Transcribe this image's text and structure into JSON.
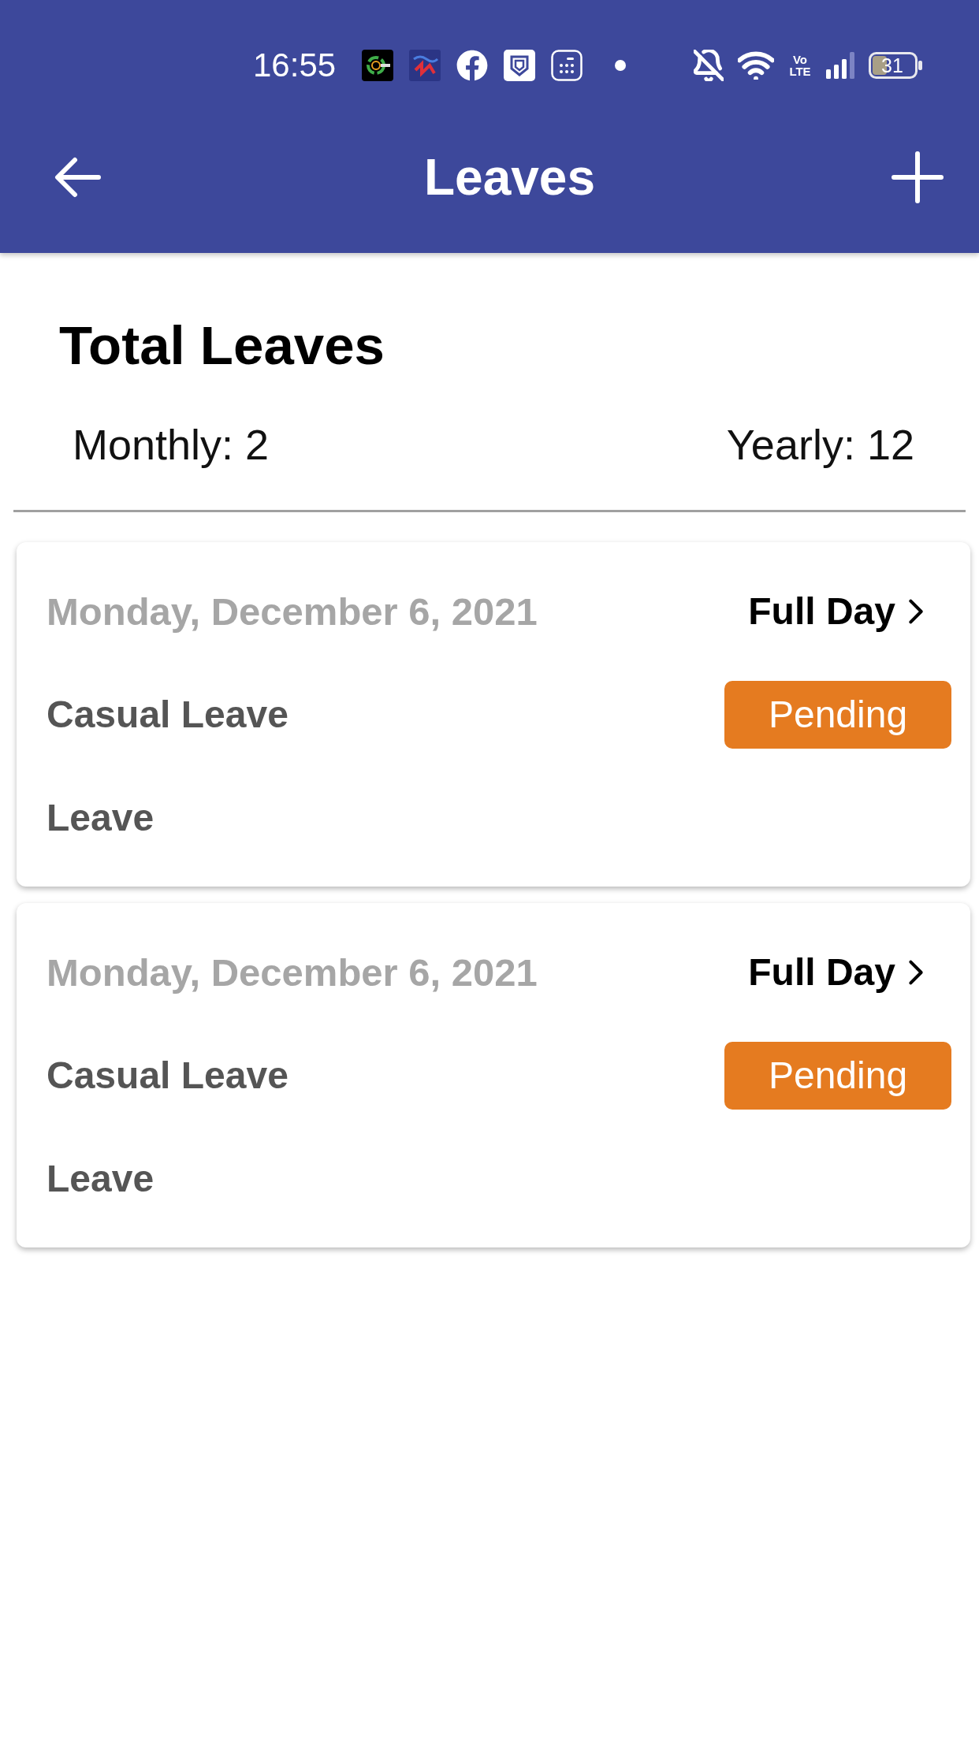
{
  "status_bar": {
    "time": "16:55",
    "network_label": "Vo LTE",
    "battery": "31"
  },
  "toolbar": {
    "title": "Leaves"
  },
  "summary": {
    "heading": "Total Leaves",
    "monthly": "Monthly: 2",
    "yearly": "Yearly: 12"
  },
  "leaves": [
    {
      "date": "Monday, December 6, 2021",
      "duration": "Full Day",
      "type": "Casual Leave",
      "status": {
        "label": "Pending",
        "color": "#e57b20"
      },
      "reason": "Leave"
    },
    {
      "date": "Monday, December 6, 2021",
      "duration": "Full Day",
      "type": "Casual Leave",
      "status": {
        "label": "Pending",
        "color": "#e57b20"
      },
      "reason": "Leave"
    }
  ]
}
